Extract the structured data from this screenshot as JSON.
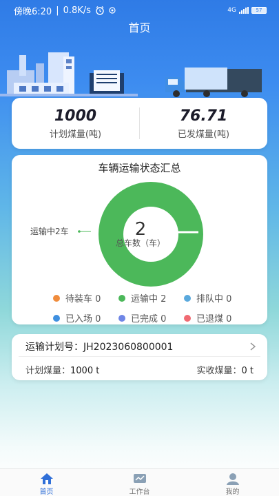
{
  "status_bar": {
    "time": "傍晚6:20",
    "speed": "0.8K/s",
    "network": "4G",
    "battery": "57"
  },
  "header": {
    "title": "首页"
  },
  "summary": {
    "planned": {
      "value": "1000",
      "label": "计划煤量(吨)"
    },
    "shipped": {
      "value": "76.71",
      "label": "已发煤量(吨)"
    }
  },
  "transport_status": {
    "title": "车辆运输状态汇总",
    "total_value": "2",
    "total_label": "总车数（车）",
    "callout": "运输中2车",
    "legend": [
      {
        "label": "待装车 0",
        "color": "#f08c3c",
        "value": 0
      },
      {
        "label": "运输中 2",
        "color": "#4cb85a",
        "value": 2
      },
      {
        "label": "排队中 0",
        "color": "#5aa9dd",
        "value": 0
      },
      {
        "label": "已入场 0",
        "color": "#3f90e0",
        "value": 0
      },
      {
        "label": "已完成 0",
        "color": "#6f86e6",
        "value": 0
      },
      {
        "label": "已退煤 0",
        "color": "#f06a72",
        "value": 0
      }
    ]
  },
  "plan": {
    "number_label": "运输计划号：",
    "number": "JH2023060800001",
    "planned_label": "计划煤量：",
    "planned_value": "1000 t",
    "received_label": "实收煤量：",
    "received_value": "0 t"
  },
  "tabs": [
    {
      "label": "首页",
      "icon": "home-icon",
      "active": true
    },
    {
      "label": "工作台",
      "icon": "workbench-chart-icon",
      "active": false
    },
    {
      "label": "我的",
      "icon": "profile-icon",
      "active": false
    }
  ],
  "colors": {
    "primary": "#2f7be6",
    "donut": "#4cb85a",
    "tab_active": "#2f6fd8"
  }
}
